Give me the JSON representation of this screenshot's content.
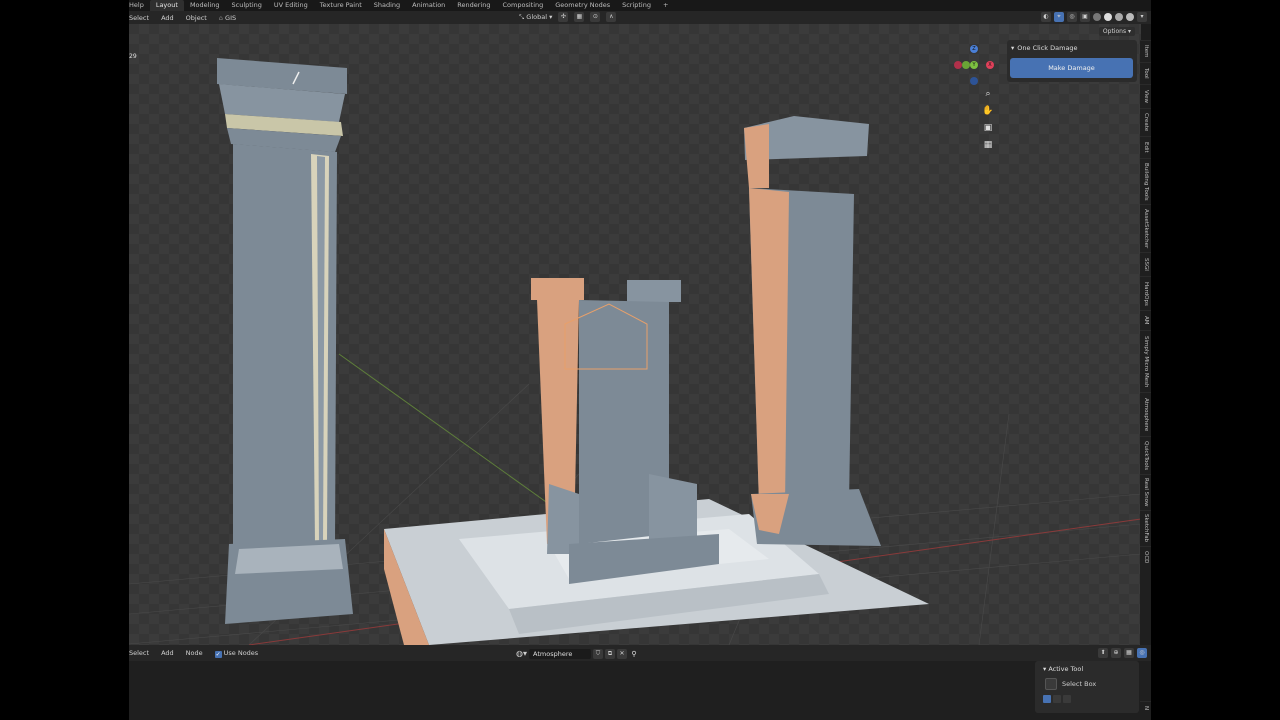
{
  "menubar": {
    "items": [
      "Help",
      "Layout",
      "Modeling",
      "Sculpting",
      "UV Editing",
      "Texture Paint",
      "Shading",
      "Animation",
      "Rendering",
      "Compositing",
      "Geometry Nodes",
      "Scripting",
      "+"
    ],
    "active_index": 1
  },
  "toolbar": {
    "left_items": [
      "Select",
      "Add",
      "Object",
      "GIS"
    ],
    "orientation": "Global",
    "options_label": "Options"
  },
  "viewport": {
    "frame_label": "29",
    "gizmo_axes": {
      "x": "X",
      "y": "Y",
      "z": "Z"
    },
    "icons": [
      "zoom-icon",
      "pan-hand-icon",
      "camera-icon",
      "grid-icon"
    ]
  },
  "npanel": {
    "panel_title": "One Click Damage",
    "button_label": "Make Damage",
    "tabs": [
      "Item",
      "Tool",
      "View",
      "Create",
      "Edit",
      "Building Tools",
      "AssetSketcher",
      "SSGI",
      "HardOps",
      "AM",
      "Simply Micro Mesh",
      "Atmosphere",
      "QuickTools",
      "Real Snow",
      "SketchFab",
      "OCD"
    ]
  },
  "node_editor": {
    "header_items": [
      "Select",
      "Add",
      "Node"
    ],
    "use_nodes_label": "Use Nodes",
    "world_name": "Atmosphere",
    "active_tool": {
      "title": "Active Tool",
      "tool_name": "Select Box"
    },
    "side_tab": "N"
  },
  "colors": {
    "accent": "#4772b3",
    "selected_orange": "#d9a17f",
    "object_grey": "#7d8a96",
    "viewport_bg": "#393939"
  }
}
